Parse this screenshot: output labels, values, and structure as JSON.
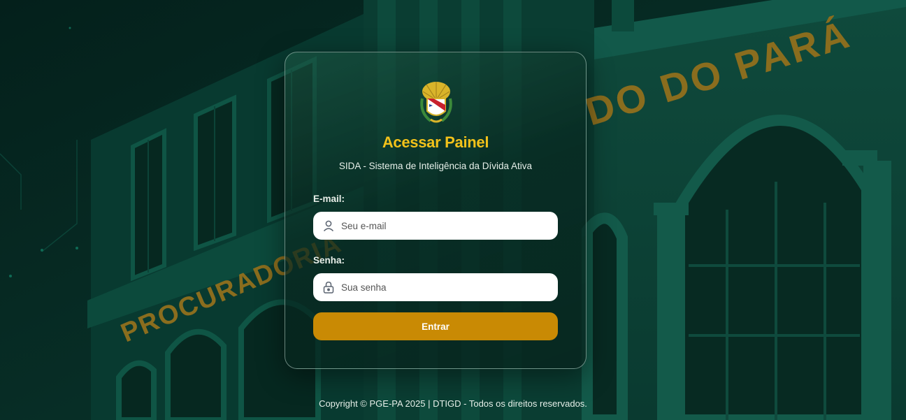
{
  "background": {
    "facade_text_left": "PROCURADORIA",
    "facade_text_right": "DO DO PARÁ"
  },
  "login": {
    "title": "Acessar Painel",
    "subtitle": "SIDA - Sistema de Inteligência da Dívida Ativa",
    "email_label": "E-mail:",
    "email_placeholder": "Seu e-mail",
    "email_value": "",
    "password_label": "Senha:",
    "password_placeholder": "Sua senha",
    "password_value": "",
    "submit_label": "Entrar",
    "email_icon": "user-icon",
    "password_icon": "lock-icon",
    "crest": "para-coat-of-arms"
  },
  "footer": {
    "copyright": "Copyright © PGE-PA 2025 | DTIGD - Todos os direitos reservados."
  },
  "colors": {
    "accent_gold": "#f3c21a",
    "button": "#c98a04",
    "background": "#062a22"
  }
}
